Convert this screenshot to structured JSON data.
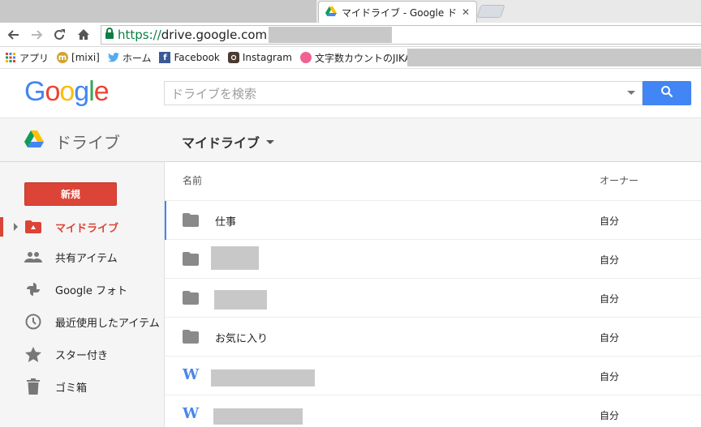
{
  "browser": {
    "tab_title": "マイドライブ - Google ドライブ",
    "url_scheme": "https://",
    "url_host": "drive.google.com",
    "bookmarks": [
      {
        "label": "アプリ",
        "icon": "apps-grid-icon"
      },
      {
        "label": "[mixi]",
        "icon": "mixi-icon"
      },
      {
        "label": "ホーム",
        "icon": "twitter-icon"
      },
      {
        "label": "Facebook",
        "icon": "facebook-icon"
      },
      {
        "label": "Instagram",
        "icon": "instagram-icon"
      },
      {
        "label": "文字数カウントのJIKA...",
        "icon": "site-favicon-icon"
      }
    ]
  },
  "google_header": {
    "logo": "Google",
    "search_placeholder": "ドライブを検索"
  },
  "drive_header": {
    "product_label": "ドライブ",
    "location_title": "マイドライブ"
  },
  "sidebar": {
    "new_button": "新規",
    "items": [
      {
        "label": "マイドライブ",
        "icon": "my-drive-icon",
        "active": true
      },
      {
        "label": "共有アイテム",
        "icon": "shared-people-icon"
      },
      {
        "label": "Google フォト",
        "icon": "google-photos-icon"
      },
      {
        "label": "最近使用したアイテム",
        "icon": "clock-icon"
      },
      {
        "label": "スター付き",
        "icon": "star-icon"
      },
      {
        "label": "ゴミ箱",
        "icon": "trash-icon"
      }
    ]
  },
  "file_list": {
    "columns": {
      "name": "名前",
      "owner": "オーナー"
    },
    "rows": [
      {
        "type": "folder",
        "name": "仕事",
        "owner": "自分"
      },
      {
        "type": "folder",
        "name": "",
        "owner": "自分"
      },
      {
        "type": "folder",
        "name": "",
        "owner": "自分"
      },
      {
        "type": "folder",
        "name": "お気に入り",
        "owner": "自分"
      },
      {
        "type": "word",
        "name": "",
        "owner": "自分"
      },
      {
        "type": "word",
        "name": "",
        "owner": "自分"
      }
    ]
  },
  "colors": {
    "accent_red": "#db4437",
    "accent_blue": "#4285f4",
    "url_green": "#0b8043"
  }
}
